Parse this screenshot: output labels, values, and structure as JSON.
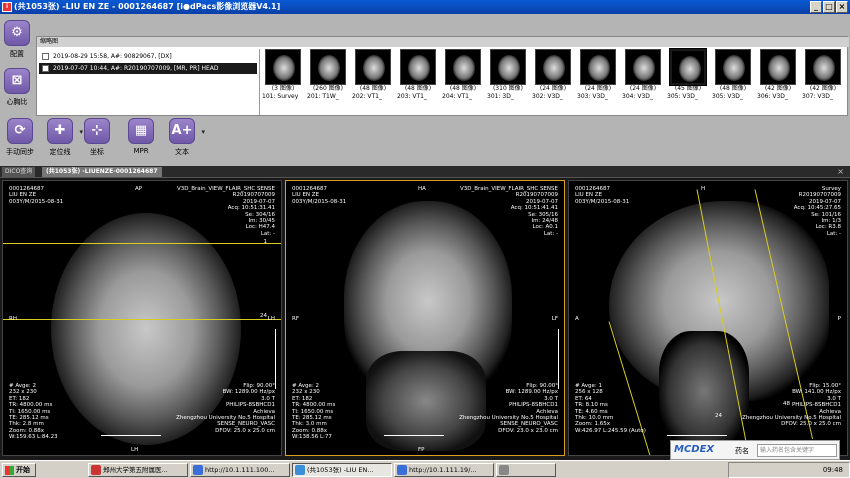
{
  "titlebar": {
    "title": "(共1053张) -LIU EN ZE - 0001264687 [i●dPacs影像浏览器V4.1]",
    "min": "_",
    "max": "□",
    "close": "×"
  },
  "toolbar": {
    "tools": [
      {
        "key": "config",
        "label": "配置",
        "glyph": "⚙"
      },
      {
        "key": "ratio",
        "label": "心胸比",
        "glyph": "⊠"
      },
      {
        "key": "sync",
        "label": "手动同步",
        "glyph": "⟳"
      },
      {
        "key": "locate",
        "label": "定位线",
        "glyph": "✚"
      },
      {
        "key": "coord",
        "label": "坐标",
        "glyph": "⊹"
      },
      {
        "key": "mpr",
        "label": "MPR",
        "glyph": "▦"
      },
      {
        "key": "text",
        "label": "文本",
        "glyph": "A+"
      }
    ]
  },
  "thumbnails": {
    "header": "缩略图",
    "studies": [
      {
        "text": "2019-08-29 15:58, A#: 90829067, [DX]",
        "selected": false
      },
      {
        "text": "2019-07-07 10:44, A#: R20190707009, [MR, PR] HEAD",
        "selected": true
      }
    ],
    "series": [
      {
        "count": "(3 图像)",
        "name": "101: Survey"
      },
      {
        "count": "(260 图像)",
        "name": "201: T1W_"
      },
      {
        "count": "(48 图像)",
        "name": "202: VT1_"
      },
      {
        "count": "(48 图像)",
        "name": "203: VT1_"
      },
      {
        "count": "(48 图像)",
        "name": "204: VT1_"
      },
      {
        "count": "(310 图像)",
        "name": "301: 3D_"
      },
      {
        "count": "(24 图像)",
        "name": "302: V3D_"
      },
      {
        "count": "(24 图像)",
        "name": "303: V3D_"
      },
      {
        "count": "(24 图像)",
        "name": "304: V3D_"
      },
      {
        "count": "(45 图像)",
        "name": "305: V3D_"
      },
      {
        "count": "(48 图像)",
        "name": "305: V3D_"
      },
      {
        "count": "(42 图像)",
        "name": "306: V3D_"
      },
      {
        "count": "(42 图像)",
        "name": "307: V3D_"
      }
    ]
  },
  "subbar": {
    "tab1": "DICO查询",
    "tab2": "(共1053张) -LIUENZE-0001264687",
    "close": "×"
  },
  "viewports": [
    {
      "tl": "0001264687\nLIU EN ZE\n003Y/M/2015-08-31",
      "top": "AP",
      "tr": "V3D_Brain_VIEW_FLAIR_SHC SENSE\nR20190707009\n2019-07-07\nAcq: 10:51:31.41\nSe: 304/16\nIm: 30/45\nLoc: H47.4\nLat: -",
      "left": "RH",
      "right": "LH",
      "line1": "1",
      "line2": "24",
      "bl": "# Avge: 2\n232 x 230\nET: 182\nTR: 4800.00 ms\nTI: 1650.00 ms\nTE: 285.12 ms\nThk: 2.8 mm\nZoom: 0.88x\nW:159.63 L:84.23",
      "br": "Flip: 90.00°\nBW: 1289.00 Hz/px\n3.0 T\nPHILIPS-8SBHCD1\nAchieva\nZhengzhou University No.5 Hospital\nSENSE_NEURO_VASC\nDFOV: 25.0 x 25.0 cm",
      "bottom": "LH"
    },
    {
      "tl": "0001264687\nLIU EN ZE\n003Y/M/2015-08-31",
      "top": "HA",
      "tr": "V3D_Brain_VIEW_FLAIR_SHC SENSE\nR20190707009\n2019-07-07\nAcq: 10:51:41.41\nSe: 305/16\nIm: 24/48\nLoc: A0.1\nLat: -",
      "left": "RF",
      "right": "LF",
      "line1": "",
      "line2": "",
      "bl": "# Avge: 2\n232 x 230\nET: 182\nTR: 4800.00 ms\nTI: 1650.00 ms\nTE: 285.12 ms\nThk: 3.0 mm\nZoom: 0.88x\nW:138.56 L:77",
      "br": "Flip: 90.00°\nBW: 1289.00 Hz/px\n3.0 T\nPHILIPS-8SBHCD1\nAchieva\nZhengzhou University No.5 Hospital\nSENSE_NEURO_VASC\nDFOV: 23.0 x 23.0 cm",
      "bottom": "FP"
    },
    {
      "tl": "0001264687\nLIU EN ZE\n003Y/M/2015-08-31",
      "top": "H",
      "tr": "Survey\nR20190707009\n2019-07-07\nAcq: 10:45:27.65\nSe: 101/16\nIm: 1/3\nLoc: R3.8\nLat: -",
      "left": "A",
      "right": "P",
      "line1": "48",
      "line2": "24",
      "bl": "# Avge: 1\n256 x 128\nET: 64\nTR: 8.10 ms\nTE: 4.60 ms\nThk: 10.0 mm\nZoom: 1.65x\nW:426.97 L:245.59 (Auto)",
      "br": "Flip: 15.00°\nBW: 141.00 Hz/px\n3.0 T\nPHILIPS-8SBHCD1\nAchieva\nZhengzhou University No.5 Hospital\nDFOV: 25.0 x 25.0 cm",
      "bottom": "F"
    }
  ],
  "mcdex": {
    "brand": "MCDEX",
    "field": "药名",
    "placeholder": "输入药名包含关键字"
  },
  "taskbar": {
    "start": "开始",
    "tasks": [
      {
        "label": "郑州大学第五附属医...",
        "color": "#c33"
      },
      {
        "label": "http://10.1.111.100...",
        "color": "#3a6fd8"
      },
      {
        "label": "(共1053张) -LIU EN...",
        "color": "#3a8fd8",
        "active": true
      },
      {
        "label": "http://10.1.111.19/...",
        "color": "#3a6fd8"
      },
      {
        "label": "",
        "color": "#888"
      }
    ],
    "time": "09:48"
  }
}
